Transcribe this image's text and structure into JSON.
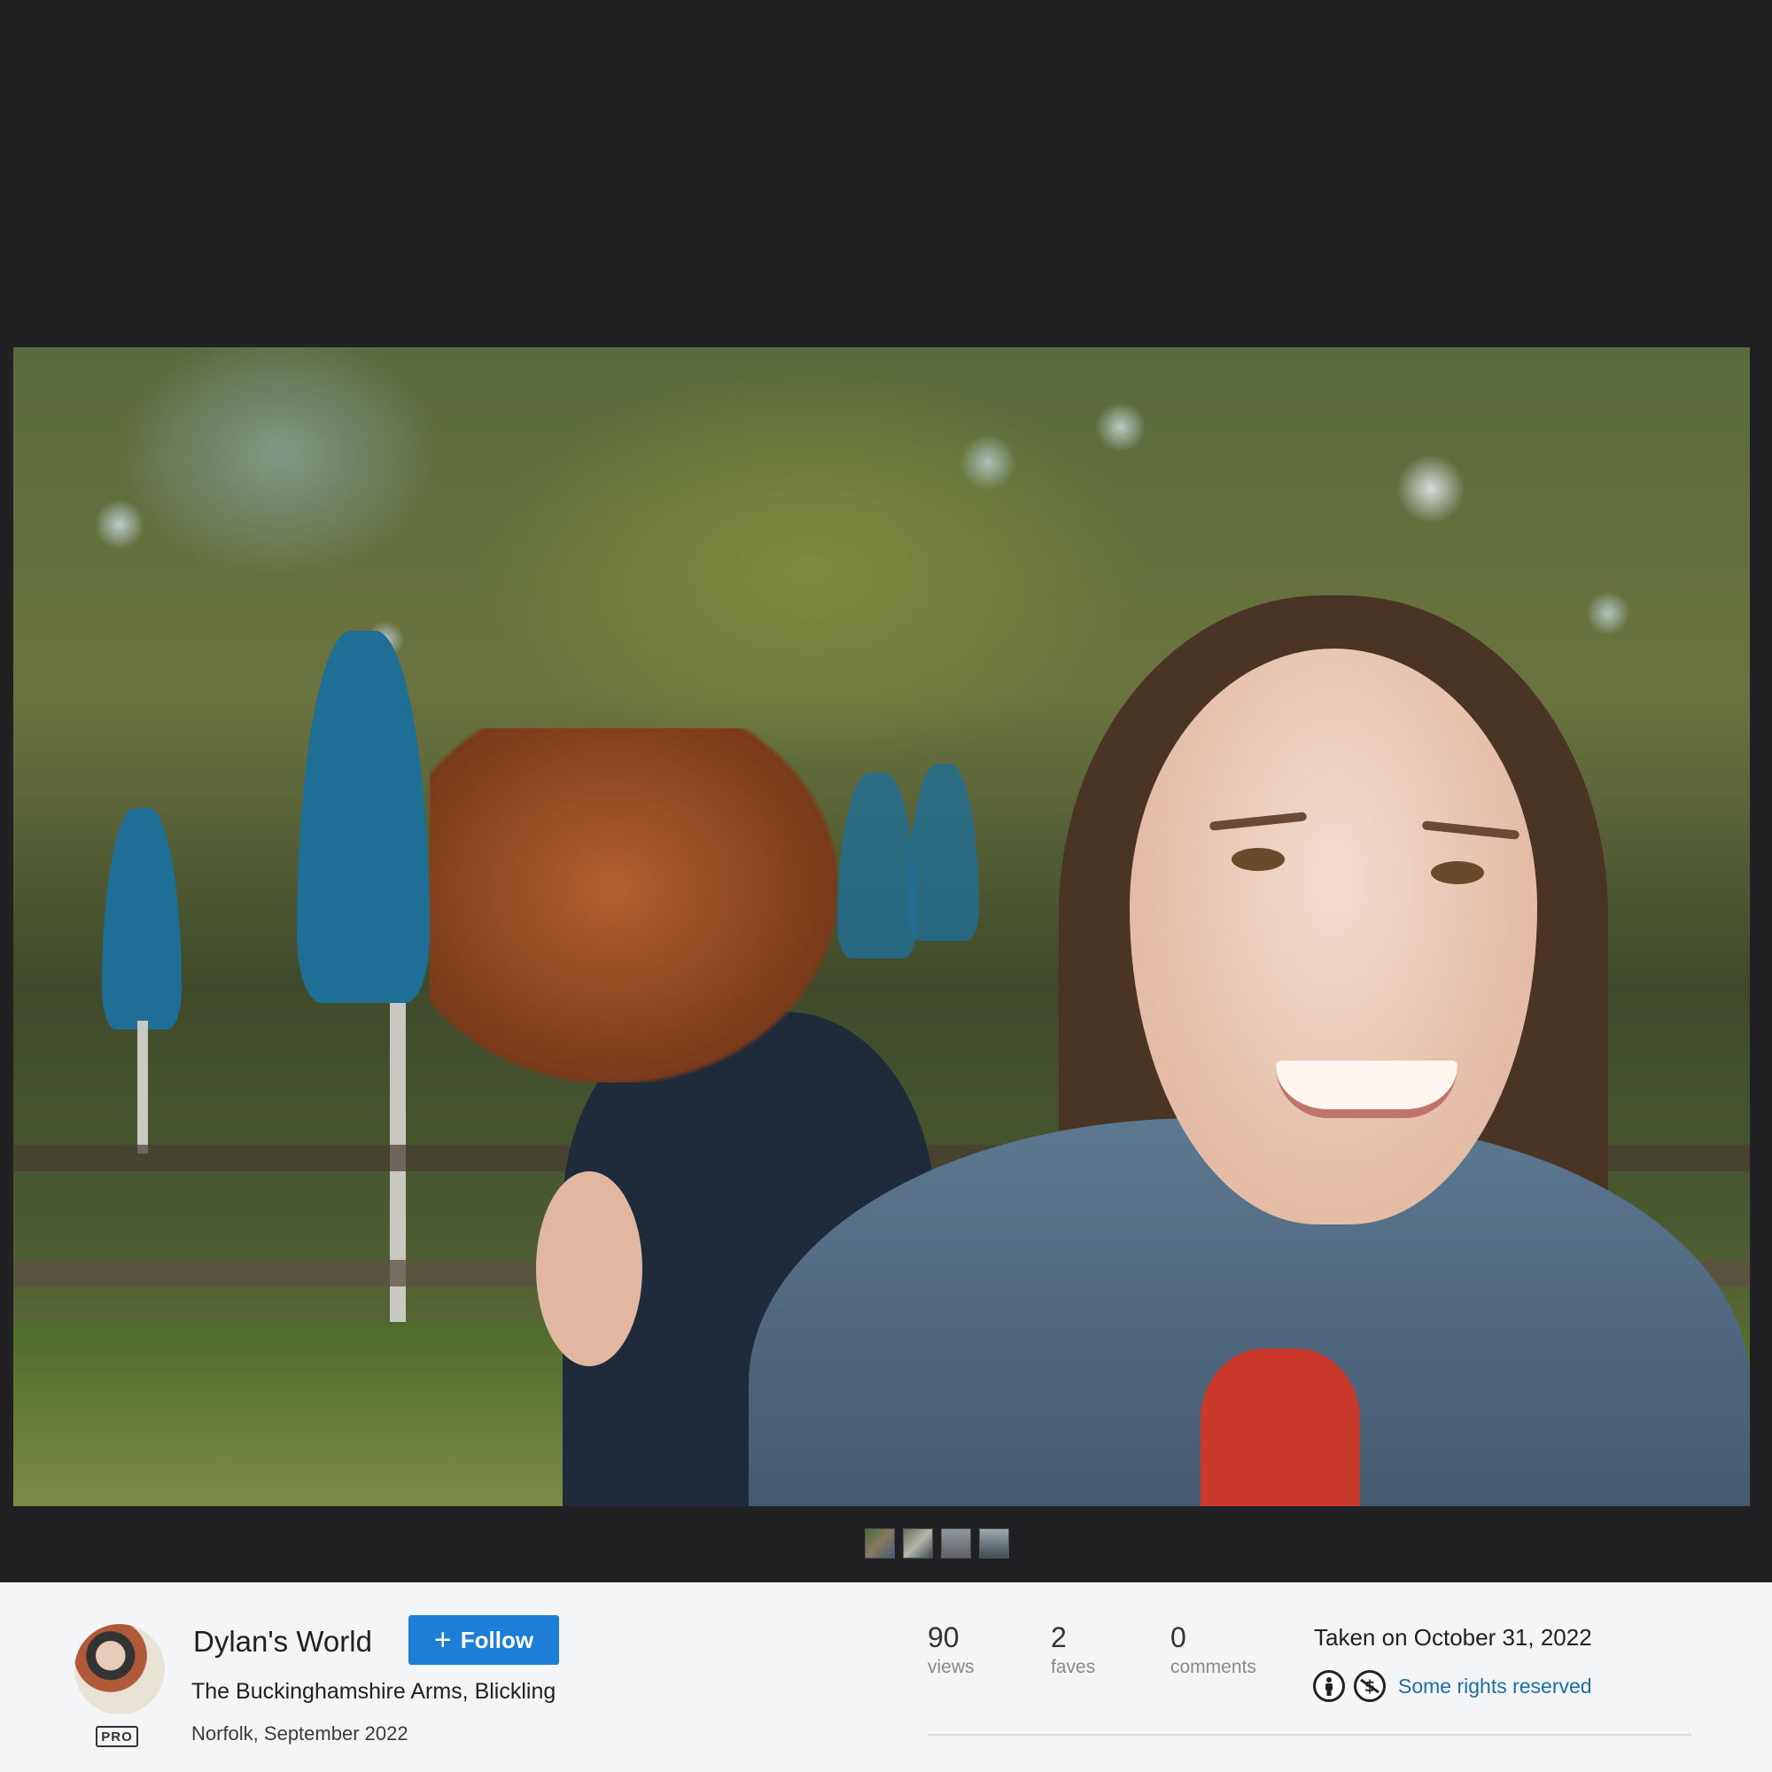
{
  "owner": {
    "name": "Dylan's World",
    "badge": "PRO",
    "follow_label": "Follow",
    "follow_icon": "plus-icon"
  },
  "photo": {
    "title": "The Buckinghamshire Arms, Blickling",
    "description": "Norfolk, September 2022",
    "taken_label": "Taken on October 31, 2022"
  },
  "stats": [
    {
      "value": "90",
      "label": "views"
    },
    {
      "value": "2",
      "label": "faves"
    },
    {
      "value": "0",
      "label": "comments"
    }
  ],
  "license": {
    "icons": [
      "cc-by-icon",
      "cc-nc-icon"
    ],
    "label": "Some rights reserved"
  },
  "colors": {
    "viewer_bg": "#212124",
    "info_bg": "#f4f5f7",
    "follow_bg": "#1c7ed6",
    "link": "#1c6ea4"
  }
}
